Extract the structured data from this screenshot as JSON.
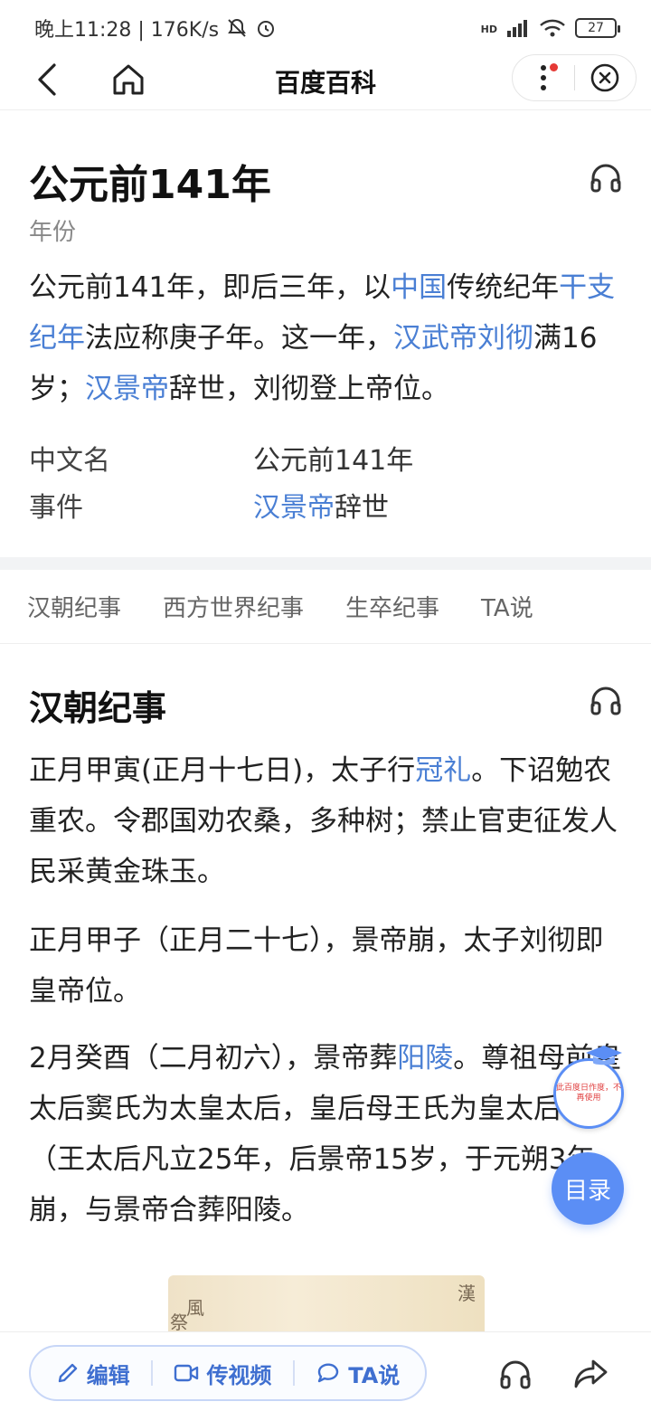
{
  "status_bar": {
    "time_speed": "晚上11:28 | 176K/s",
    "network_label": "HD",
    "battery": "27"
  },
  "nav": {
    "title": "百度百科"
  },
  "article": {
    "title": "公元前141年",
    "subtitle": "年份",
    "summary": {
      "t1": "公元前141年，即后三年，以",
      "l1": "中国",
      "t2": "传统纪年",
      "l2": "干支纪年",
      "t3": "法应称庚子年。这一年，",
      "l3": "汉武帝刘彻",
      "t4": "满16岁；",
      "l4": "汉景帝",
      "t5": "辞世，刘彻登上帝位。"
    },
    "infobox": [
      {
        "key": "中文名",
        "value": "公元前141年"
      },
      {
        "key": "事件",
        "link": "汉景帝",
        "value": "辞世"
      }
    ]
  },
  "tabs": [
    "汉朝纪事",
    "西方世界纪事",
    "生卒纪事",
    "TA说"
  ],
  "section": {
    "title": "汉朝纪事",
    "p1": {
      "t1": "正月甲寅(正月十七日)，太子行",
      "l1": "冠礼",
      "t2": "。下诏勉农重农。令郡国劝农桑，多种树；禁止官吏征发人民采黄金珠玉。"
    },
    "p2": "正月甲子（正月二十七），景帝崩，太子刘彻即皇帝位。",
    "p3": {
      "t1": "2月癸酉（二月初六），景帝葬",
      "l1": "阳陵",
      "t2": "。尊祖母前皇太后窦氏为太皇太后，皇后母王氏为皇太后。（王太后凡立25年，后景帝15岁，于元朔3年崩，与景帝合葬阳陵。"
    }
  },
  "floating": {
    "badge_text": "此百度日作度，不再使用",
    "toc_label": "目录"
  },
  "bottom": {
    "edit_label": "编辑",
    "video_label": "传视频",
    "ta_label": "TA说"
  },
  "colors": {
    "link": "#4a7fd4",
    "accent": "#5b8ef5"
  }
}
